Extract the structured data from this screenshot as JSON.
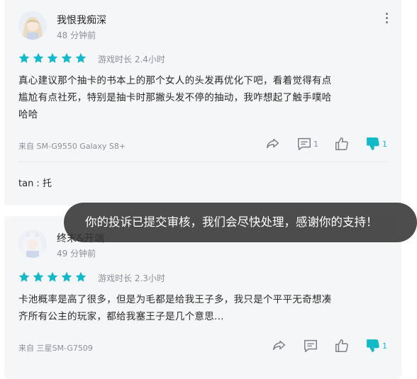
{
  "reviews": [
    {
      "username": "我恨我痴深",
      "time": "48 分钟前",
      "rating": 5,
      "playtime": "游戏时长 2.4小时",
      "content_line1": "真心建议那个抽卡的书本上的那个女人的头发再优化下吧，看着觉得有点",
      "content_line2": "尴尬有点社死，特别是抽卡时那撇头发不停的抽动，我咋想起了触手噗哈",
      "content_line3": "哈哈",
      "device": "来自 SM-G9550 Galaxy S8+",
      "reply_count": "1",
      "dislike_count": "1",
      "reply_preview": "tan : 托"
    },
    {
      "username": "终末&开端",
      "time": "49 分钟前",
      "rating": 5,
      "playtime": "游戏时长 2.3小时",
      "content_line1": "卡池概率是高了很多，但是为毛都是给我王子多，我只是个平平无奇想凑",
      "content_line2": "齐所有公主的玩家，都给我塞王子是几个意思...",
      "device": "来自 三星SM-G7509",
      "dislike_count": "1"
    }
  ],
  "toast": {
    "message": "你的投诉已提交审核，我们会尽快处理，感谢你的支持！"
  },
  "colors": {
    "star": "#14b9c8",
    "dislike_active": "#14b9c8",
    "icon": "#7a7f88"
  }
}
